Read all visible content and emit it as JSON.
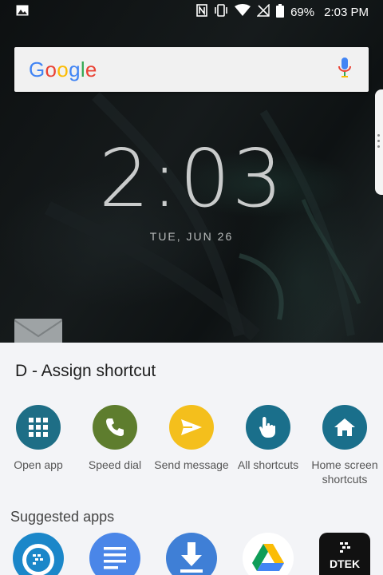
{
  "status_bar": {
    "battery_percent": "69%",
    "time": "2:03 PM"
  },
  "search": {
    "logo_letters": [
      "G",
      "o",
      "o",
      "g",
      "l",
      "e"
    ],
    "logo_colors": [
      "#4285F4",
      "#EA4335",
      "#FBBC05",
      "#4285F4",
      "#34A853",
      "#EA4335"
    ]
  },
  "clock": {
    "time": "2:03",
    "date": "TUE, JUN 26"
  },
  "sheet": {
    "title": "D - Assign shortcut",
    "actions": [
      {
        "label": "Open app",
        "icon": "grid-icon",
        "color": "#1e6e86"
      },
      {
        "label": "Speed dial",
        "icon": "phone-icon",
        "color": "#5e7d2e"
      },
      {
        "label": "Send message",
        "icon": "send-icon",
        "color": "#f4bf1c"
      },
      {
        "label": "All shortcuts",
        "icon": "hand-pointer-icon",
        "color": "#1a6f8b"
      },
      {
        "label": "Home screen\nshortcuts",
        "icon": "home-icon",
        "color": "#1a6f8b"
      }
    ],
    "suggested_title": "Suggested apps",
    "suggested_apps": [
      {
        "icon": "blackberry-search-icon",
        "color": "#1b87c9"
      },
      {
        "icon": "docs-icon",
        "color": "#4a86e8"
      },
      {
        "icon": "download-icon",
        "color": "#3f7fd6"
      },
      {
        "icon": "google-drive-icon",
        "color": "#ffffff"
      },
      {
        "icon": "dtek-icon",
        "color": "#111111",
        "text": "DTEK"
      }
    ]
  }
}
